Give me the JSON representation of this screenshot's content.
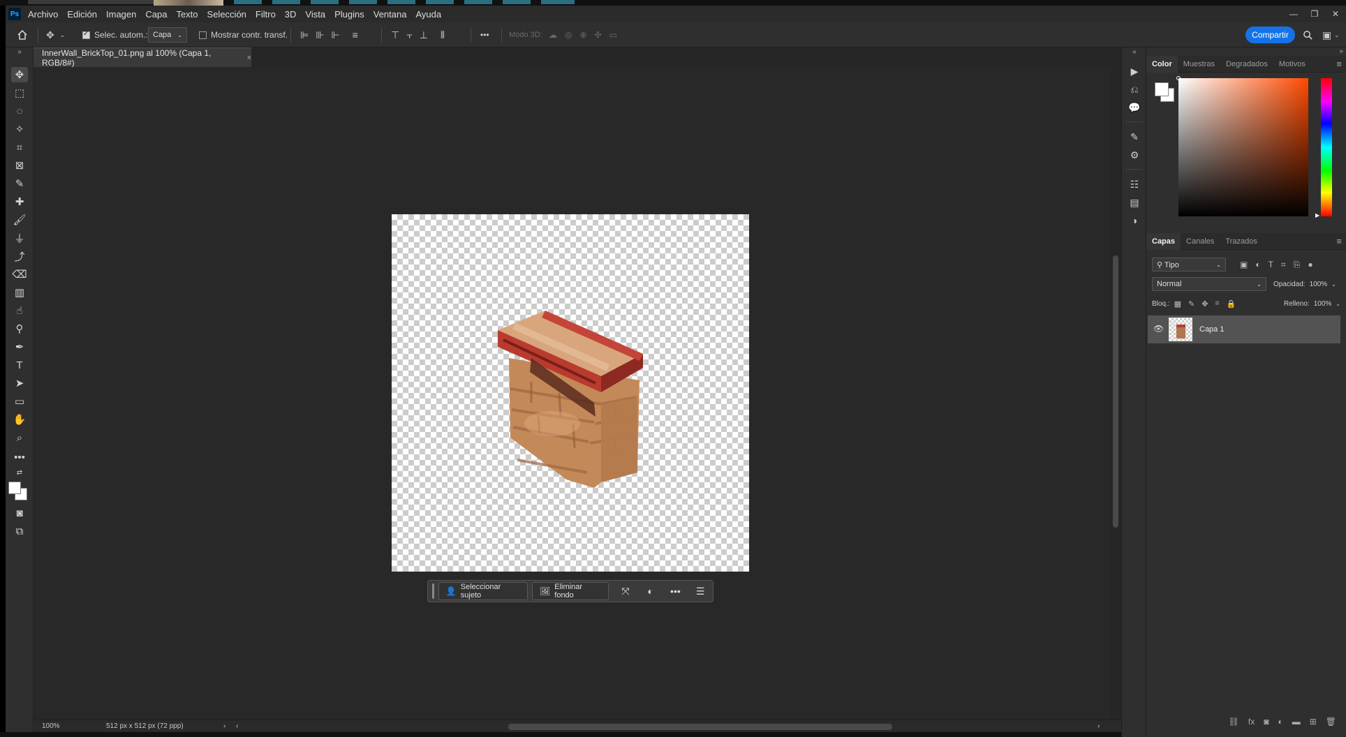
{
  "app": {
    "logo_text": "Ps",
    "menu": [
      "Archivo",
      "Edición",
      "Imagen",
      "Capa",
      "Texto",
      "Selección",
      "Filtro",
      "3D",
      "Vista",
      "Plugins",
      "Ventana",
      "Ayuda"
    ],
    "window_controls": {
      "minimize": "—",
      "restore": "❐",
      "close": "✕"
    }
  },
  "options_bar": {
    "auto_select_label": "Selec. autom.:",
    "auto_select_checked": true,
    "auto_select_target": "Capa",
    "show_transform_label": "Mostrar contr. transf.",
    "show_transform_checked": false,
    "mode_3d_label": "Modo 3D:",
    "more": "•••",
    "share_label": "Compartir"
  },
  "document": {
    "tab_title": "InnerWall_BrickTop_01.png al 100% (Capa 1, RGB/8#)",
    "close": "×"
  },
  "task_bar": {
    "select_subject": "Seleccionar sujeto",
    "remove_background": "Eliminar fondo",
    "more": "•••"
  },
  "status_bar": {
    "zoom": "100%",
    "doc_info": "512 px x 512 px (72 ppp)",
    "arrow": "›"
  },
  "color_panel": {
    "tabs": [
      "Color",
      "Muestras",
      "Degradados",
      "Motivos"
    ],
    "active_tab": "Color",
    "foreground": "#ffffff",
    "background": "#ffffff"
  },
  "layers_panel": {
    "tabs": [
      "Capas",
      "Canales",
      "Trazados"
    ],
    "active_tab": "Capas",
    "filter_kind": "Tipo",
    "blend_mode": "Normal",
    "opacity_label": "Opacidad:",
    "opacity_value": "100%",
    "lock_label": "Bloq.:",
    "fill_label": "Relleno:",
    "fill_value": "100%",
    "layers": [
      {
        "name": "Capa 1",
        "visible": true
      }
    ]
  },
  "colors": {
    "accent": "#1473e6",
    "brick_red": "#b83b2e",
    "brick_tan": "#c78a5c"
  }
}
